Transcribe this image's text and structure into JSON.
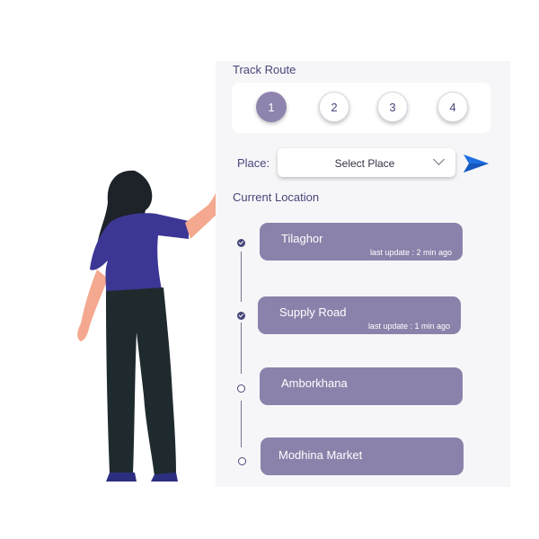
{
  "header": {
    "title": "Track Route"
  },
  "steps": [
    {
      "label": "1",
      "active": true
    },
    {
      "label": "2",
      "active": false
    },
    {
      "label": "3",
      "active": false
    },
    {
      "label": "4",
      "active": false
    }
  ],
  "place": {
    "label": "Place:",
    "select_value": "Select Place",
    "send_icon": "send-icon"
  },
  "current_location": {
    "label": "Current Location",
    "stops": [
      {
        "name": "Tilaghor",
        "update": "last update : 2 min ago",
        "done": true
      },
      {
        "name": "Supply Road",
        "update": "last update : 1 min ago",
        "done": true
      },
      {
        "name": "Amborkhana",
        "done": false
      },
      {
        "name": "Modhina Market",
        "done": false
      }
    ]
  },
  "colors": {
    "accent": "#8b82ab",
    "text": "#47467a",
    "send": "#1e6fe0"
  }
}
